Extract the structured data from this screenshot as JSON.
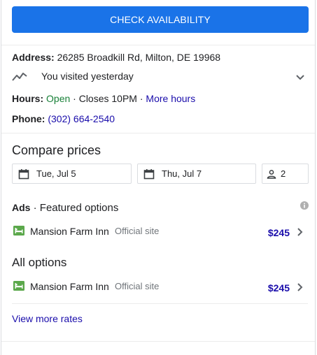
{
  "cta": {
    "label": "CHECK AVAILABILITY"
  },
  "address": {
    "label": "Address:",
    "value": "26285 Broadkill Rd, Milton, DE 19968"
  },
  "visited": {
    "text": "You visited yesterday",
    "icon": "trend-line-icon"
  },
  "hours": {
    "label": "Hours:",
    "status": "Open",
    "separator1": " · Closes 10PM · ",
    "more_link": "More hours"
  },
  "phone": {
    "label": "Phone:",
    "value": "(302) 664-2540"
  },
  "compare": {
    "title": "Compare prices",
    "check_in": "Tue, Jul 5",
    "check_out": "Thu, Jul 7",
    "guests": "2"
  },
  "featured": {
    "ads_label": "Ads",
    "title": " · Featured options",
    "options": [
      {
        "name": "Mansion Farm Inn",
        "site": "Official site",
        "price": "$245"
      }
    ]
  },
  "all_options": {
    "title": "All options",
    "options": [
      {
        "name": "Mansion Farm Inn",
        "site": "Official site",
        "price": "$245"
      }
    ]
  },
  "view_more": "View more rates",
  "colors": {
    "accent": "#1a73e8",
    "link": "#1a0dab",
    "open": "#188038",
    "hotel_icon": "#5ba84b"
  }
}
